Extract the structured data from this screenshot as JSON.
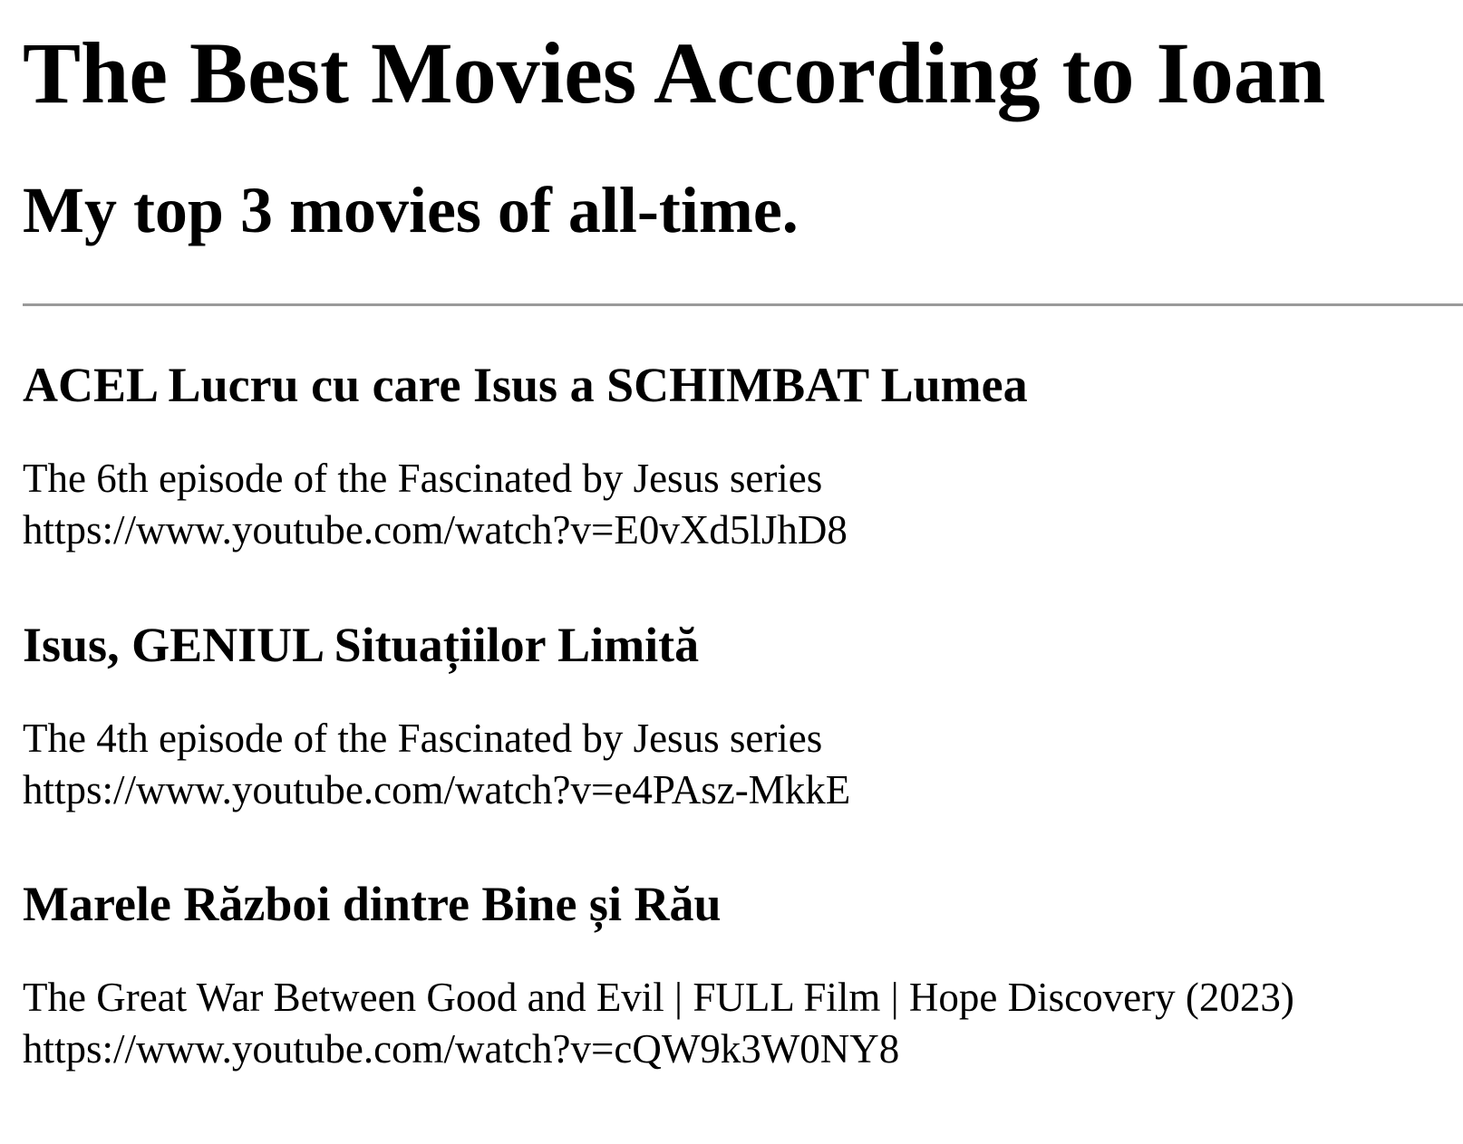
{
  "page": {
    "title": "The Best Movies According to Ioan",
    "subtitle": "My top 3 movies of all-time."
  },
  "movies": [
    {
      "title": "ACEL Lucru cu care Isus a SCHIMBAT Lumea",
      "description": "The 6th episode of the Fascinated by Jesus series",
      "url": "https://www.youtube.com/watch?v=E0vXd5lJhD8"
    },
    {
      "title": "Isus, GENIUL Situațiilor Limită",
      "description": "The 4th episode of the Fascinated by Jesus series",
      "url": "https://www.youtube.com/watch?v=e4PAsz-MkkE"
    },
    {
      "title": "Marele Război dintre Bine și Rău",
      "description": "The Great War Between Good and Evil | FULL Film | Hope Discovery (2023)",
      "url": "https://www.youtube.com/watch?v=cQW9k3W0NY8"
    }
  ]
}
